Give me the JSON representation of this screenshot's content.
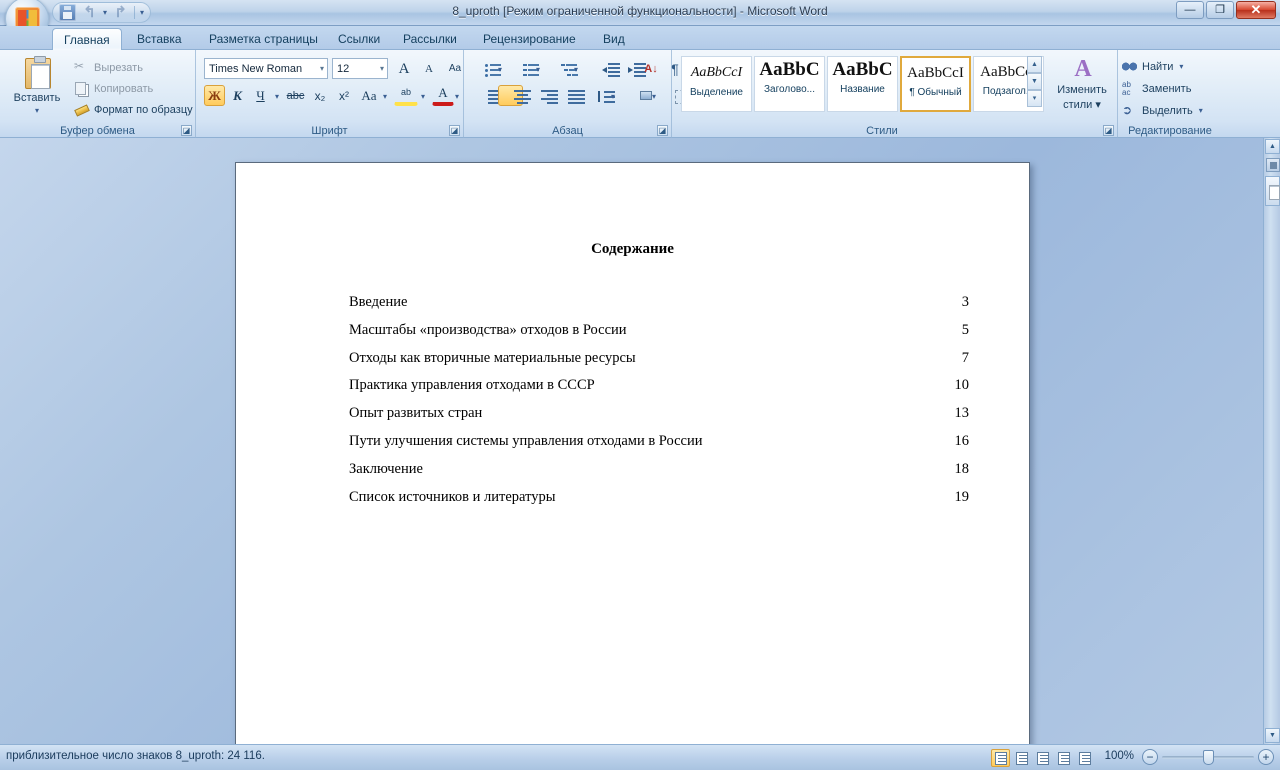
{
  "window": {
    "title": "8_uproth [Режим ограниченной функциональности] - Microsoft Word",
    "minimize_label": "—",
    "restore_label": "❐",
    "close_label": "✕"
  },
  "quick_access": {
    "save_label": "Сохранить",
    "undo_label": "Отменить",
    "redo_label": "Вернуть",
    "customize_label": "Настройка панели быстрого доступа",
    "undo_glyph": "↰",
    "redo_glyph": "↱",
    "caret_glyph": "▾"
  },
  "tabs": [
    {
      "label": "Главная",
      "active": true
    },
    {
      "label": "Вставка",
      "active": false
    },
    {
      "label": "Разметка страницы",
      "active": false
    },
    {
      "label": "Ссылки",
      "active": false
    },
    {
      "label": "Рассылки",
      "active": false
    },
    {
      "label": "Рецензирование",
      "active": false
    },
    {
      "label": "Вид",
      "active": false
    }
  ],
  "ribbon": {
    "clipboard": {
      "group_title": "Буфер обмена",
      "paste_label": "Вставить",
      "paste_caret": "▾",
      "cut_label": "Вырезать",
      "copy_label": "Копировать",
      "format_painter_label": "Формат по образцу",
      "dialog_launcher": "◪"
    },
    "font": {
      "group_title": "Шрифт",
      "font_name": "Times New Roman",
      "font_size": "12",
      "caret": "▾",
      "grow_font": "A",
      "shrink_font": "A",
      "clear_formatting": "Aa",
      "bold": "Ж",
      "italic": "К",
      "underline": "Ч",
      "strikethrough": "abc",
      "subscript": "x₂",
      "superscript": "x²",
      "change_case": "Aa",
      "highlight": "ab",
      "font_color": "A",
      "dialog_launcher": "◪"
    },
    "paragraph": {
      "group_title": "Абзац",
      "bullets": "Маркеры",
      "numbering": "Нумерация",
      "multilevel": "Многоуровневый список",
      "decrease_indent": "Уменьшить отступ",
      "increase_indent": "Увеличить отступ",
      "sort": "Сортировка",
      "show_marks": "¶",
      "align_left": "По левому краю",
      "align_center": "По центру",
      "align_right": "По правому краю",
      "justify": "По ширине",
      "line_spacing": "Междустрочный интервал",
      "shading": "Заливка",
      "borders": "Границы",
      "dialog_launcher": "◪"
    },
    "styles": {
      "group_title": "Стили",
      "items": [
        {
          "preview": "AaBbCcI",
          "name": "Выделение",
          "selected": false,
          "italic": true,
          "size": 14
        },
        {
          "preview": "AaBbC",
          "name": "Заголово...",
          "selected": false,
          "italic": false,
          "size": 19
        },
        {
          "preview": "AaBbC",
          "name": "Название",
          "selected": false,
          "italic": false,
          "size": 19
        },
        {
          "preview": "AaBbCcI",
          "name": "¶ Обычный",
          "selected": true,
          "italic": false,
          "size": 15
        },
        {
          "preview": "AaBbCcI",
          "name": "Подзагол...",
          "selected": false,
          "italic": false,
          "size": 15
        }
      ],
      "scroll_up": "▲",
      "scroll_down": "▼",
      "scroll_more": "▾",
      "change_styles_icon": "A",
      "change_styles_line1": "Изменить",
      "change_styles_line2": "стили ▾",
      "dialog_launcher": "◪"
    },
    "editing": {
      "group_title": "Редактирование",
      "find_label": "Найти",
      "replace_label": "Заменить",
      "select_label": "Выделить",
      "caret": "▾"
    }
  },
  "document": {
    "heading": "Содержание",
    "toc": [
      {
        "title": "Введение",
        "page": "3"
      },
      {
        "title": "Масштабы «производства» отходов в России",
        "page": "5"
      },
      {
        "title": "Отходы как вторичные материальные ресурсы",
        "page": "7"
      },
      {
        "title": "Практика управления отходами в СССР",
        "page": "10"
      },
      {
        "title": "Опыт развитых стран",
        "page": "13"
      },
      {
        "title": "Пути улучшения системы управления отходами в России",
        "page": "16"
      },
      {
        "title": "Заключение",
        "page": "18"
      },
      {
        "title": "Список источников и литературы",
        "page": "19"
      }
    ]
  },
  "scrollbar": {
    "up_arrow": "▲",
    "down_arrow": "▼",
    "prev_page": "▲",
    "next_page": "▼",
    "select_browse_object": "Выбор объекта перехода"
  },
  "statusbar": {
    "text": "приблизительное число знаков 8_uproth: 24 116.",
    "zoom_level": "100%",
    "zoom_out": "−",
    "zoom_in": "+",
    "views": [
      {
        "name": "Разметка страницы",
        "active": true
      },
      {
        "name": "Режим чтения",
        "active": false
      },
      {
        "name": "Веб-документ",
        "active": false
      },
      {
        "name": "Структура",
        "active": false
      },
      {
        "name": "Черновик",
        "active": false
      }
    ]
  },
  "colors": {
    "accent": "#1c3f5e",
    "ribbon_bg": "#e3eef8",
    "selection_gold": "#ffcb5c",
    "close_red": "#d84b33",
    "desktop_blue": "#9cb8dc"
  }
}
